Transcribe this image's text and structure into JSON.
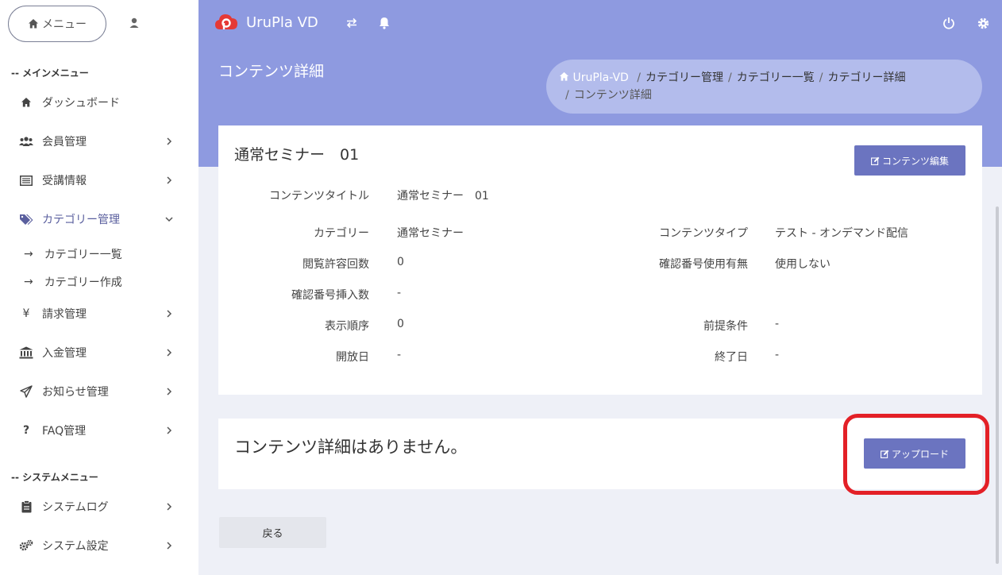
{
  "sidebar": {
    "menu_button": "メニュー",
    "main_menu_label": "-- メインメニュー",
    "system_menu_label": "-- システムメニュー",
    "items": [
      {
        "label": "ダッシュボード"
      },
      {
        "label": "会員管理"
      },
      {
        "label": "受講情報"
      },
      {
        "label": "カテゴリー管理"
      },
      {
        "label": "請求管理"
      },
      {
        "label": "入金管理"
      },
      {
        "label": "お知らせ管理"
      },
      {
        "label": "FAQ管理"
      }
    ],
    "sub_items": [
      {
        "label": "カテゴリー一覧"
      },
      {
        "label": "カテゴリー作成"
      }
    ],
    "system_items": [
      {
        "label": "システムログ"
      },
      {
        "label": "システム設定"
      }
    ],
    "arrow_glyph": "→",
    "yen_glyph": "¥",
    "question_glyph": "?"
  },
  "topbar": {
    "brand": "UruPla VD"
  },
  "header": {
    "page_title": "コンテンツ詳細",
    "breadcrumb": {
      "home": "UruPla-VD",
      "items": [
        "カテゴリー管理",
        "カテゴリー一覧",
        "カテゴリー詳細"
      ],
      "current": "コンテンツ詳細",
      "separator": "/"
    }
  },
  "content": {
    "title": "通常セミナー　01",
    "edit_button": "コンテンツ編集",
    "fields": {
      "content_title_label": "コンテンツタイトル",
      "content_title_value": "通常セミナー　01",
      "category_label": "カテゴリー",
      "category_value": "通常セミナー",
      "content_type_label": "コンテンツタイプ",
      "content_type_value": "テスト - オンデマンド配信",
      "view_count_label": "閲覧許容回数",
      "view_count_value": "0",
      "confirm_use_label": "確認番号使用有無",
      "confirm_use_value": "使用しない",
      "confirm_insert_label": "確認番号挿入数",
      "confirm_insert_value": "-",
      "display_order_label": "表示順序",
      "display_order_value": "0",
      "prerequisite_label": "前提条件",
      "prerequisite_value": "-",
      "open_date_label": "開放日",
      "open_date_value": "-",
      "end_date_label": "終了日",
      "end_date_value": "-"
    }
  },
  "details": {
    "empty_message": "コンテンツ詳細はありません。",
    "upload_button": "アップロード"
  },
  "footer": {
    "back_button": "戻る"
  },
  "colors": {
    "header": "#8e9ae0",
    "primary_button": "#6b74c0",
    "highlight": "#e32027",
    "brand_logo": "#e53935"
  }
}
